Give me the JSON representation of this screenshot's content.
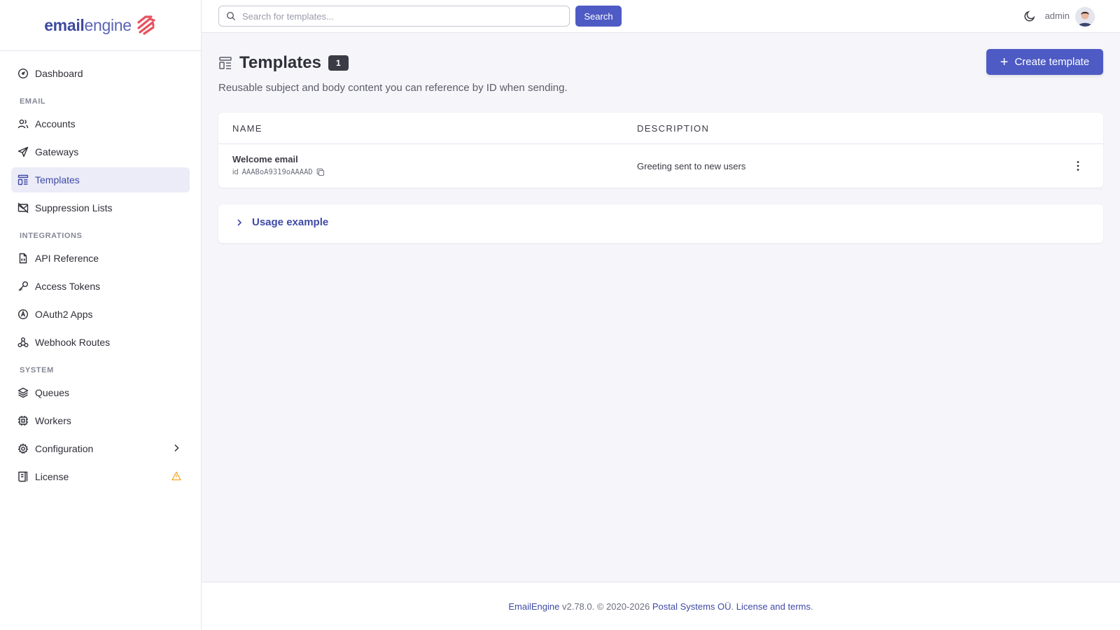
{
  "brand": {
    "part1": "email",
    "part2": "engine"
  },
  "sidebar": {
    "dashboard": "Dashboard",
    "sections": {
      "email": "EMAIL",
      "integrations": "INTEGRATIONS",
      "system": "SYSTEM"
    },
    "items": {
      "accounts": "Accounts",
      "gateways": "Gateways",
      "templates": "Templates",
      "suppression": "Suppression Lists",
      "api_reference": "API Reference",
      "access_tokens": "Access Tokens",
      "oauth2_apps": "OAuth2 Apps",
      "webhook_routes": "Webhook Routes",
      "queues": "Queues",
      "workers": "Workers",
      "configuration": "Configuration",
      "license": "License"
    },
    "active": "templates",
    "icons": [
      "dashboard-icon",
      "users-icon",
      "send-icon",
      "template-icon",
      "mail-off-icon",
      "file-code-icon",
      "key-icon",
      "brand-openai-icon",
      "webhook-icon",
      "stack-icon",
      "cpu-icon",
      "settings-icon",
      "license-icon",
      "chevron-right-icon",
      "alert-triangle-icon"
    ],
    "warning_color": "#f6a623"
  },
  "topbar": {
    "search_placeholder": "Search for templates...",
    "search_value": "",
    "search_button": "Search",
    "user": "admin",
    "icons": [
      "search-icon",
      "moon-icon",
      "avatar"
    ]
  },
  "page": {
    "title": "Templates",
    "count": "1",
    "subtitle": "Reusable subject and body content you can reference by ID when sending.",
    "create_button": "Create template",
    "accent_color": "#4e5bc4"
  },
  "table": {
    "columns": [
      "NAME",
      "DESCRIPTION"
    ],
    "rows": [
      {
        "name": "Welcome email",
        "id_label": "id",
        "id": "AAABoA9319oAAAAD",
        "description": "Greeting sent to new users"
      }
    ]
  },
  "usage": {
    "label": "Usage example"
  },
  "footer": {
    "product": "EmailEngine",
    "version_text": " v2.78.0. © 2020-2026 ",
    "company": "Postal Systems OÜ",
    "sep": ". ",
    "license_link": "License and terms",
    "end": "."
  }
}
